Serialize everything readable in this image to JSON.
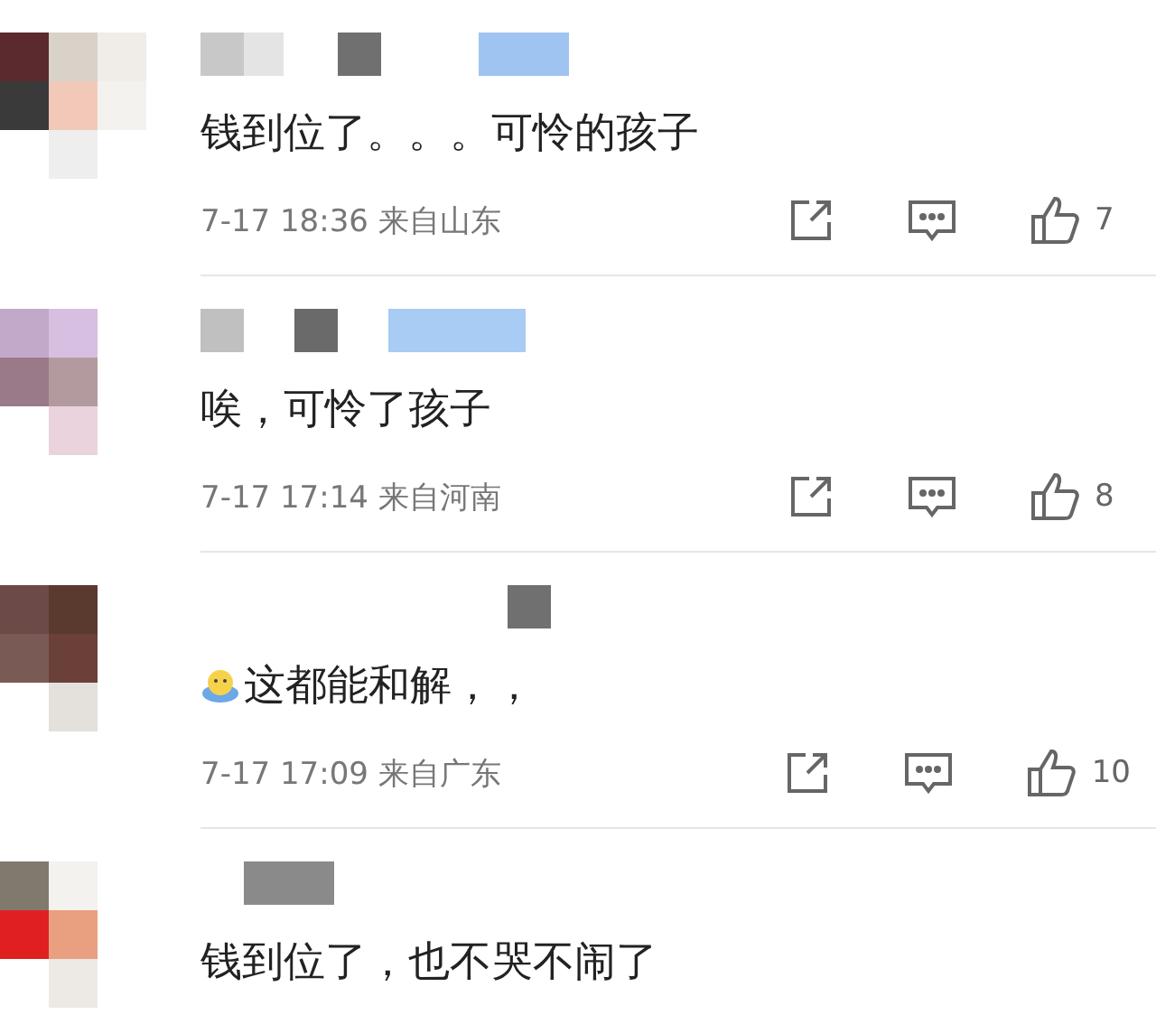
{
  "comments": [
    {
      "text": "钱到位了。。。可怜的孩子",
      "emoji": false,
      "date": "7-17",
      "time": "18:36",
      "source": "来自山东",
      "likes": "7"
    },
    {
      "text": "唉，可怜了孩子",
      "emoji": false,
      "date": "7-17",
      "time": "17:14",
      "source": "来自河南",
      "likes": "8"
    },
    {
      "text": "这都能和解，，",
      "emoji": true,
      "date": "7-17",
      "time": "17:09",
      "source": "来自广东",
      "likes": "10"
    },
    {
      "text": "钱到位了，也不哭不闹了",
      "emoji": false
    }
  ]
}
